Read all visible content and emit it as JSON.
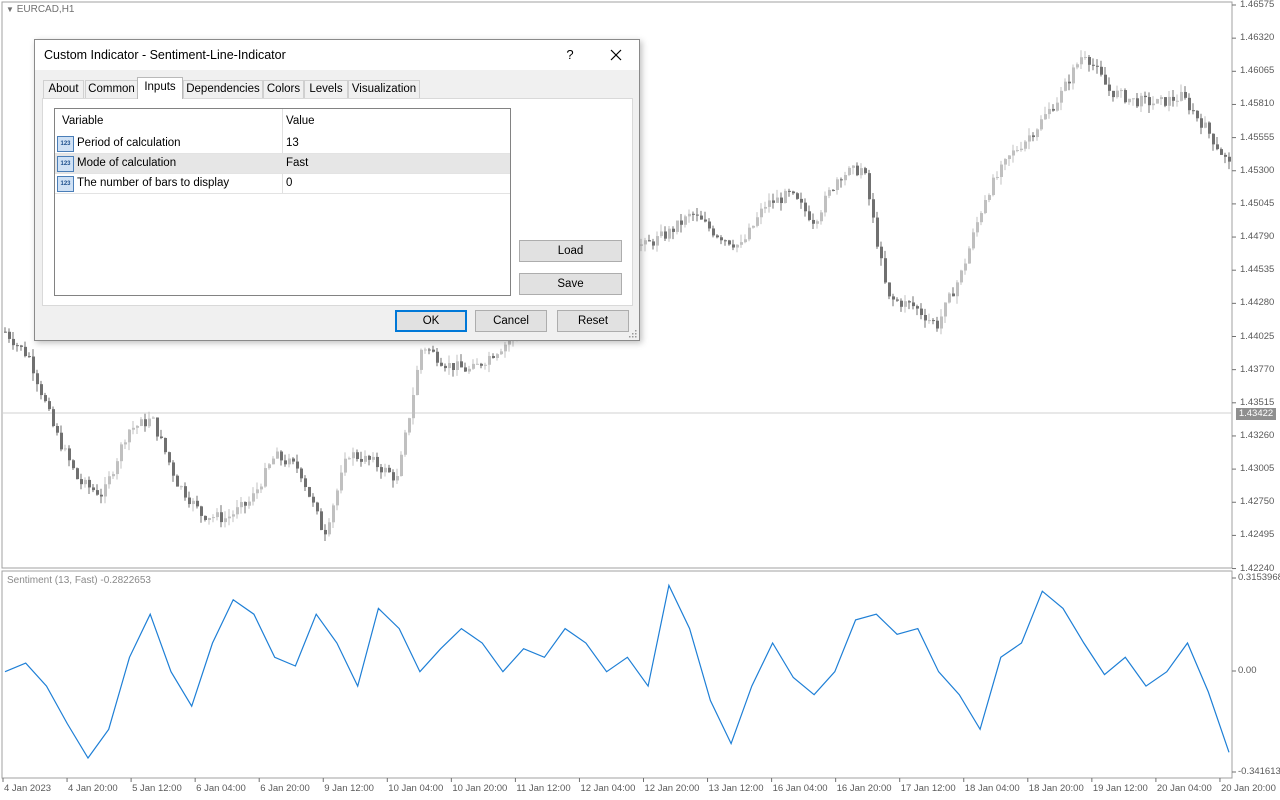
{
  "chart": {
    "symbol": "EURCAD,H1",
    "indicator_label": "Sentiment (13, Fast) -0.2822653",
    "current_price": "1.43422",
    "price_axis": [
      "1.46575",
      "1.46320",
      "1.46065",
      "1.45810",
      "1.45555",
      "1.45300",
      "1.45045",
      "1.44790",
      "1.44535",
      "1.44280",
      "1.44025",
      "1.43770",
      "1.43515",
      "1.43260",
      "1.43005",
      "1.42750",
      "1.42495",
      "1.42240"
    ],
    "indicator_axis": [
      "0.3153968",
      "0.00",
      "-0.341613"
    ],
    "time_axis": [
      "4 Jan 2023",
      "4 Jan 20:00",
      "5 Jan 12:00",
      "6 Jan 04:00",
      "6 Jan 20:00",
      "9 Jan 12:00",
      "10 Jan 04:00",
      "10 Jan 20:00",
      "11 Jan 12:00",
      "12 Jan 04:00",
      "12 Jan 20:00",
      "13 Jan 12:00",
      "16 Jan 04:00",
      "16 Jan 20:00",
      "17 Jan 12:00",
      "18 Jan 04:00",
      "18 Jan 20:00",
      "19 Jan 12:00",
      "20 Jan 04:00",
      "20 Jan 20:00"
    ],
    "colors": {
      "bull": "#c0c0c0",
      "bear": "#707070",
      "line": "#1e7fd6",
      "grid": "#d8d8d8"
    }
  },
  "chart_data": [
    {
      "type": "line",
      "title": "EURCAD,H1",
      "xlabel": "",
      "ylabel": "",
      "ylim": [
        1.4224,
        1.46575
      ],
      "series": [
        {
          "name": "EURCAD,H1",
          "values": [
            1.4405,
            1.4385,
            1.433,
            1.429,
            1.428,
            1.433,
            1.4338,
            1.429,
            1.4265,
            1.4262,
            1.4275,
            1.431,
            1.43,
            1.425,
            1.4312,
            1.4305,
            1.4292,
            1.4395,
            1.438,
            1.4375,
            1.439,
            1.4405,
            1.448,
            1.451,
            1.4508,
            1.449,
            1.447,
            1.448,
            1.4495,
            1.448,
            1.447,
            1.4502,
            1.451,
            1.449,
            1.4525,
            1.453,
            1.443,
            1.4425,
            1.441,
            1.445,
            1.451,
            1.454,
            1.456,
            1.4585,
            1.462,
            1.459,
            1.4582,
            1.458,
            1.4585,
            1.456,
            1.453
          ]
        }
      ]
    },
    {
      "type": "line",
      "title": "Sentiment (13, Fast) -0.2822653",
      "xlabel": "",
      "ylabel": "",
      "ylim": [
        -0.341613,
        0.3153968
      ],
      "series": [
        {
          "name": "Sentiment (13, Fast)",
          "values": [
            0.0,
            0.03,
            -0.05,
            -0.18,
            -0.3,
            -0.2,
            0.05,
            0.2,
            0.0,
            -0.12,
            0.1,
            0.25,
            0.2,
            0.05,
            0.02,
            0.2,
            0.1,
            -0.05,
            0.22,
            0.15,
            0.0,
            0.08,
            0.15,
            0.1,
            0.0,
            0.08,
            0.05,
            0.15,
            0.1,
            0.0,
            0.05,
            -0.05,
            0.3,
            0.15,
            -0.1,
            -0.25,
            -0.05,
            0.1,
            -0.02,
            -0.08,
            0.0,
            0.18,
            0.2,
            0.13,
            0.15,
            0.0,
            -0.08,
            -0.2,
            0.05,
            0.1,
            0.28,
            0.22,
            0.1,
            -0.01,
            0.05,
            -0.05,
            0.0,
            0.1,
            -0.07,
            -0.28
          ]
        }
      ]
    }
  ],
  "dialog": {
    "title": "Custom Indicator - Sentiment-Line-Indicator",
    "help_label": "?",
    "tabs": [
      "About",
      "Common",
      "Inputs",
      "Dependencies",
      "Colors",
      "Levels",
      "Visualization"
    ],
    "active_tab": "Inputs",
    "grid": {
      "headers": [
        "Variable",
        "Value"
      ],
      "rows": [
        {
          "variable": "Period of calculation",
          "value": "13",
          "icon": "integer-icon"
        },
        {
          "variable": "Mode of calculation",
          "value": "Fast",
          "icon": "integer-icon"
        },
        {
          "variable": "The number of bars to display",
          "value": "0",
          "icon": "integer-icon"
        }
      ],
      "selected_row": 1
    },
    "load_label": "Load",
    "save_label": "Save",
    "ok_label": "OK",
    "cancel_label": "Cancel",
    "reset_label": "Reset",
    "icon_text": "123"
  }
}
